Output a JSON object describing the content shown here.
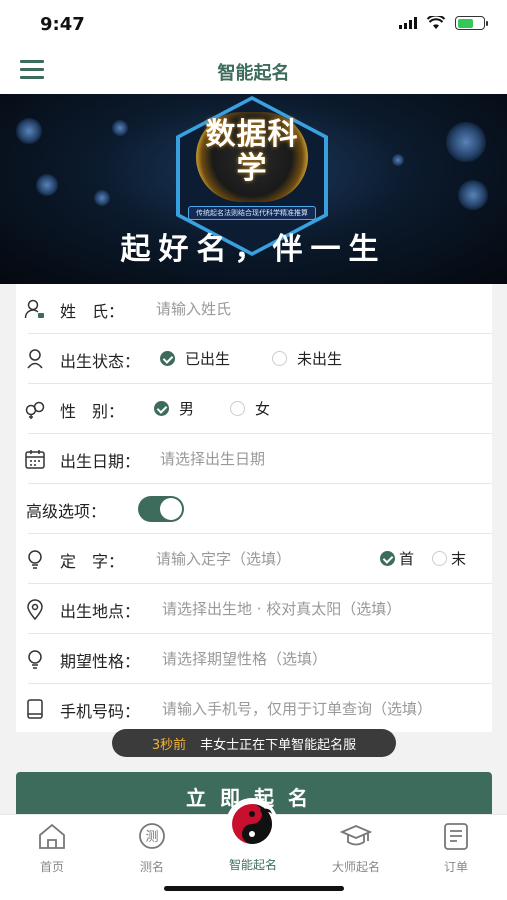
{
  "status": {
    "time": "9:47"
  },
  "nav": {
    "title": "智能起名",
    "menu_icon": "hamburger-icon"
  },
  "banner": {
    "seal_text": "数据科学",
    "ribbon_text": "传统起名法则结合现代科学精准推算",
    "slogan": "起好名，伴一生"
  },
  "form": {
    "surname": {
      "label": "姓　氏：",
      "placeholder": "请输入姓氏"
    },
    "birth_status": {
      "label": "出生状态：",
      "options": [
        "已出生",
        "未出生"
      ],
      "selected": "已出生"
    },
    "gender": {
      "label": "性　别：",
      "options": [
        "男",
        "女"
      ],
      "selected": "男"
    },
    "birth_date": {
      "label": "出生日期：",
      "placeholder": "请选择出生日期"
    },
    "advanced": {
      "label": "高级选项：",
      "enabled": true
    },
    "fixed_char": {
      "label": "定　字：",
      "placeholder": "请输入定字（选填）",
      "options": [
        "首",
        "末"
      ],
      "selected": "首"
    },
    "birthplace": {
      "label": "出生地点：",
      "placeholder": "请选择出生地 · 校对真太阳（选填）"
    },
    "personality": {
      "label": "期望性格：",
      "placeholder": "请选择期望性格（选填）"
    },
    "phone": {
      "label": "手机号码：",
      "placeholder": "请输入手机号，仅用于订单查询（选填）"
    }
  },
  "toast": {
    "ago": "3秒前",
    "message": "丰女士正在下单智能起名服"
  },
  "submit_label": "立即起名",
  "tabs": [
    {
      "label": "首页",
      "icon": "home-icon"
    },
    {
      "label": "测名",
      "icon": "test-name-icon"
    },
    {
      "label": "智能起名",
      "icon": "yin-yang-icon",
      "active": true
    },
    {
      "label": "大师起名",
      "icon": "graduation-cap-icon"
    },
    {
      "label": "订单",
      "icon": "order-icon"
    }
  ],
  "colors": {
    "primary": "#3e6c5c",
    "toast_bg": "#3b3b3b",
    "toast_highlight": "#f0b23a",
    "brand_red": "#c8102e"
  }
}
